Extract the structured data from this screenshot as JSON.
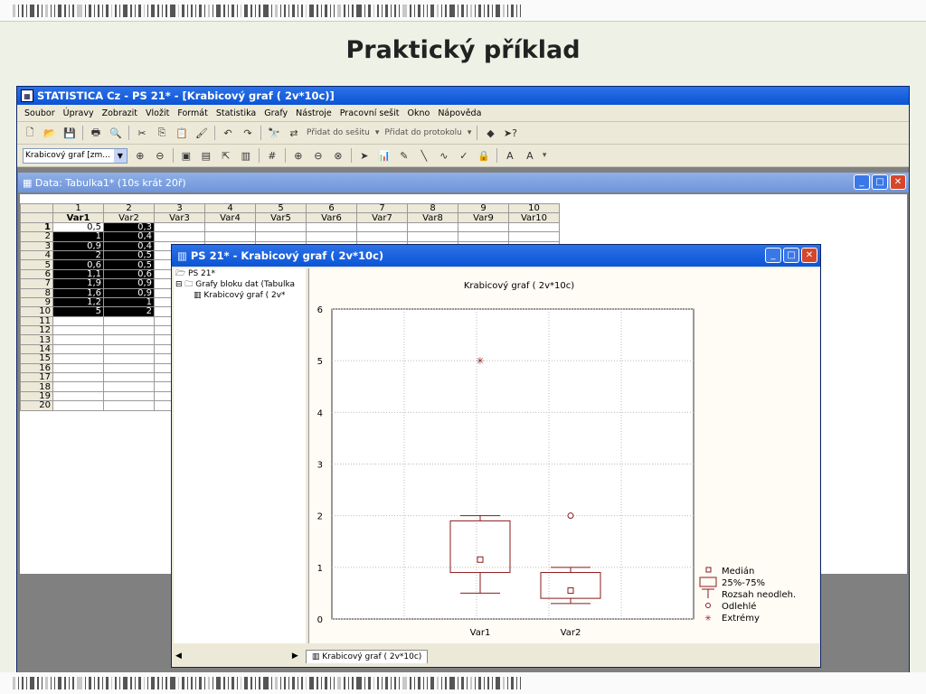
{
  "slide": {
    "title": "Praktický příklad"
  },
  "app": {
    "title": "STATISTICA Cz - PS 21* - [Krabicový graf ( 2v*10c)]"
  },
  "menu": [
    "Soubor",
    "Úpravy",
    "Zobrazit",
    "Vložit",
    "Formát",
    "Statistika",
    "Grafy",
    "Nástroje",
    "Pracovní sešit",
    "Okno",
    "Nápověda"
  ],
  "toolbar": {
    "add_to_workbook": "Přidat do sešitu",
    "add_to_report": "Přidat do protokolu",
    "graph_combo": "Krabicový graf [zm..."
  },
  "datawin": {
    "title": "Data: Tabulka1* (10s krát 20ř)",
    "col_numbers": [
      "1",
      "2",
      "3",
      "4",
      "5",
      "6",
      "7",
      "8",
      "9",
      "10"
    ],
    "col_names": [
      "Var1",
      "Var2",
      "Var3",
      "Var4",
      "Var5",
      "Var6",
      "Var7",
      "Var8",
      "Var9",
      "Var10"
    ],
    "row_numbers": [
      "1",
      "2",
      "3",
      "4",
      "5",
      "6",
      "7",
      "8",
      "9",
      "10",
      "11",
      "12",
      "13",
      "14",
      "15",
      "16",
      "17",
      "18",
      "19",
      "20"
    ],
    "var1": [
      "0,5",
      "1",
      "0,9",
      "2",
      "0,6",
      "1,1",
      "1,9",
      "1,6",
      "1,2",
      "5"
    ],
    "var2": [
      "0,3",
      "0,4",
      "0,4",
      "0,5",
      "0,5",
      "0,6",
      "0,9",
      "0,9",
      "1",
      "2"
    ]
  },
  "chartwin": {
    "title": "PS 21* - Krabicový graf ( 2v*10c)",
    "tree": {
      "root": "PS 21*",
      "folder": "Grafy bloku dat (Tabulka",
      "item": "Krabicový graf ( 2v*"
    },
    "tab": "Krabicový graf ( 2v*10c)"
  },
  "chart_data": {
    "type": "box",
    "title": "Krabicový graf ( 2v*10c)",
    "categories": [
      "Var1",
      "Var2"
    ],
    "ylim": [
      0,
      6
    ],
    "yticks": [
      "0",
      "1",
      "2",
      "3",
      "4",
      "5",
      "6"
    ],
    "grid": true,
    "legend_position": "bottom-right",
    "legend": [
      "Medián",
      "25%-75%",
      "Rozsah neodleh.",
      "Odlehlé",
      "Extrémy"
    ],
    "series": [
      {
        "name": "Var1",
        "median": 1.15,
        "q1": 0.9,
        "q3": 1.9,
        "whisker_low": 0.5,
        "whisker_high": 2,
        "outliers": [],
        "extremes": [
          5
        ]
      },
      {
        "name": "Var2",
        "median": 0.55,
        "q1": 0.4,
        "q3": 0.9,
        "whisker_low": 0.3,
        "whisker_high": 1,
        "outliers": [
          2
        ],
        "extremes": []
      }
    ],
    "color": "#8b1a1a"
  }
}
